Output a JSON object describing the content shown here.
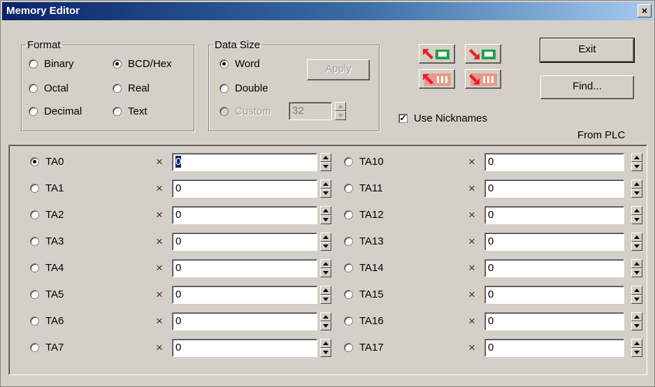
{
  "window": {
    "title": "Memory Editor",
    "close_label": "×"
  },
  "format": {
    "legend": "Format",
    "options": [
      {
        "label": "Binary",
        "checked": false
      },
      {
        "label": "Octal",
        "checked": false
      },
      {
        "label": "Decimal",
        "checked": false
      },
      {
        "label": "BCD/Hex",
        "checked": true
      },
      {
        "label": "Real",
        "checked": false
      },
      {
        "label": "Text",
        "checked": false
      }
    ]
  },
  "data_size": {
    "legend": "Data Size",
    "options": [
      {
        "label": "Word",
        "checked": true
      },
      {
        "label": "Double",
        "checked": false
      },
      {
        "label": "Custom",
        "checked": false,
        "disabled": true
      }
    ],
    "custom_value": "32",
    "apply_label": "Apply"
  },
  "transfer_icons": [
    "read-word-from-plc-icon",
    "write-word-to-plc-icon",
    "read-block-from-plc-icon",
    "write-block-to-plc-icon"
  ],
  "buttons": {
    "exit": "Exit",
    "find": "Find..."
  },
  "use_nicknames": {
    "label": "Use Nicknames",
    "checked": true
  },
  "source_label": "From PLC",
  "x_symbol": "×",
  "registers_left": [
    {
      "name": "TA0",
      "value": "0",
      "selected": true
    },
    {
      "name": "TA1",
      "value": "0"
    },
    {
      "name": "TA2",
      "value": "0"
    },
    {
      "name": "TA3",
      "value": "0"
    },
    {
      "name": "TA4",
      "value": "0"
    },
    {
      "name": "TA5",
      "value": "0"
    },
    {
      "name": "TA6",
      "value": "0"
    },
    {
      "name": "TA7",
      "value": "0"
    }
  ],
  "registers_right": [
    {
      "name": "TA10",
      "value": "0"
    },
    {
      "name": "TA11",
      "value": "0"
    },
    {
      "name": "TA12",
      "value": "0"
    },
    {
      "name": "TA13",
      "value": "0"
    },
    {
      "name": "TA14",
      "value": "0"
    },
    {
      "name": "TA15",
      "value": "0"
    },
    {
      "name": "TA16",
      "value": "0"
    },
    {
      "name": "TA17",
      "value": "0"
    }
  ],
  "colors": {
    "face": "#d4d0c8",
    "title_start": "#0a246a",
    "title_end": "#a6caf0",
    "arrow_red": "#e8202a",
    "arrow_green": "#22a050"
  }
}
